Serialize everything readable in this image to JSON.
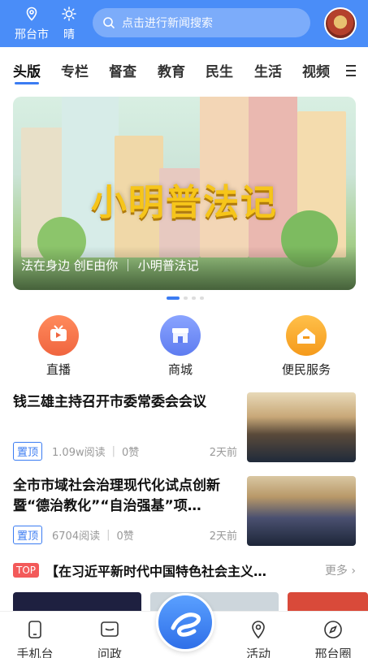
{
  "header": {
    "location": "邢台市",
    "weather": "晴",
    "search_placeholder": "点击进行新闻搜索"
  },
  "tabs": [
    "头版",
    "专栏",
    "督查",
    "教育",
    "民生",
    "生活",
    "视频"
  ],
  "banner": {
    "title": "小明普法记",
    "caption": "法在身边 创E由你 ｜ 小明普法记"
  },
  "quick_links": [
    {
      "label": "直播",
      "icon": "tv-icon",
      "color": "#f0653f"
    },
    {
      "label": "商城",
      "icon": "store-icon",
      "color": "#5e7cf0"
    },
    {
      "label": "便民服务",
      "icon": "home-icon",
      "color": "#f59a1b"
    }
  ],
  "news": [
    {
      "title": "钱三雄主持召开市委常委会会议",
      "badge": "置顶",
      "reads": "1.09w阅读",
      "likes": "0赞",
      "time": "2天前"
    },
    {
      "title": "全市市域社会治理现代化试点创新暨“德治教化”“自治强基”项…",
      "badge": "置顶",
      "reads": "6704阅读",
      "likes": "0赞",
      "time": "2天前"
    }
  ],
  "topic": {
    "badge": "TOP",
    "title": "【在习近平新时代中国特色社会主义…",
    "more": "更多"
  },
  "bottom_nav": [
    "手机台",
    "问政",
    "活动",
    "邢台圈"
  ],
  "colors": {
    "header_bg": "#4a8df8",
    "accent": "#3b7cf2",
    "top_badge": "#f35a5a"
  }
}
